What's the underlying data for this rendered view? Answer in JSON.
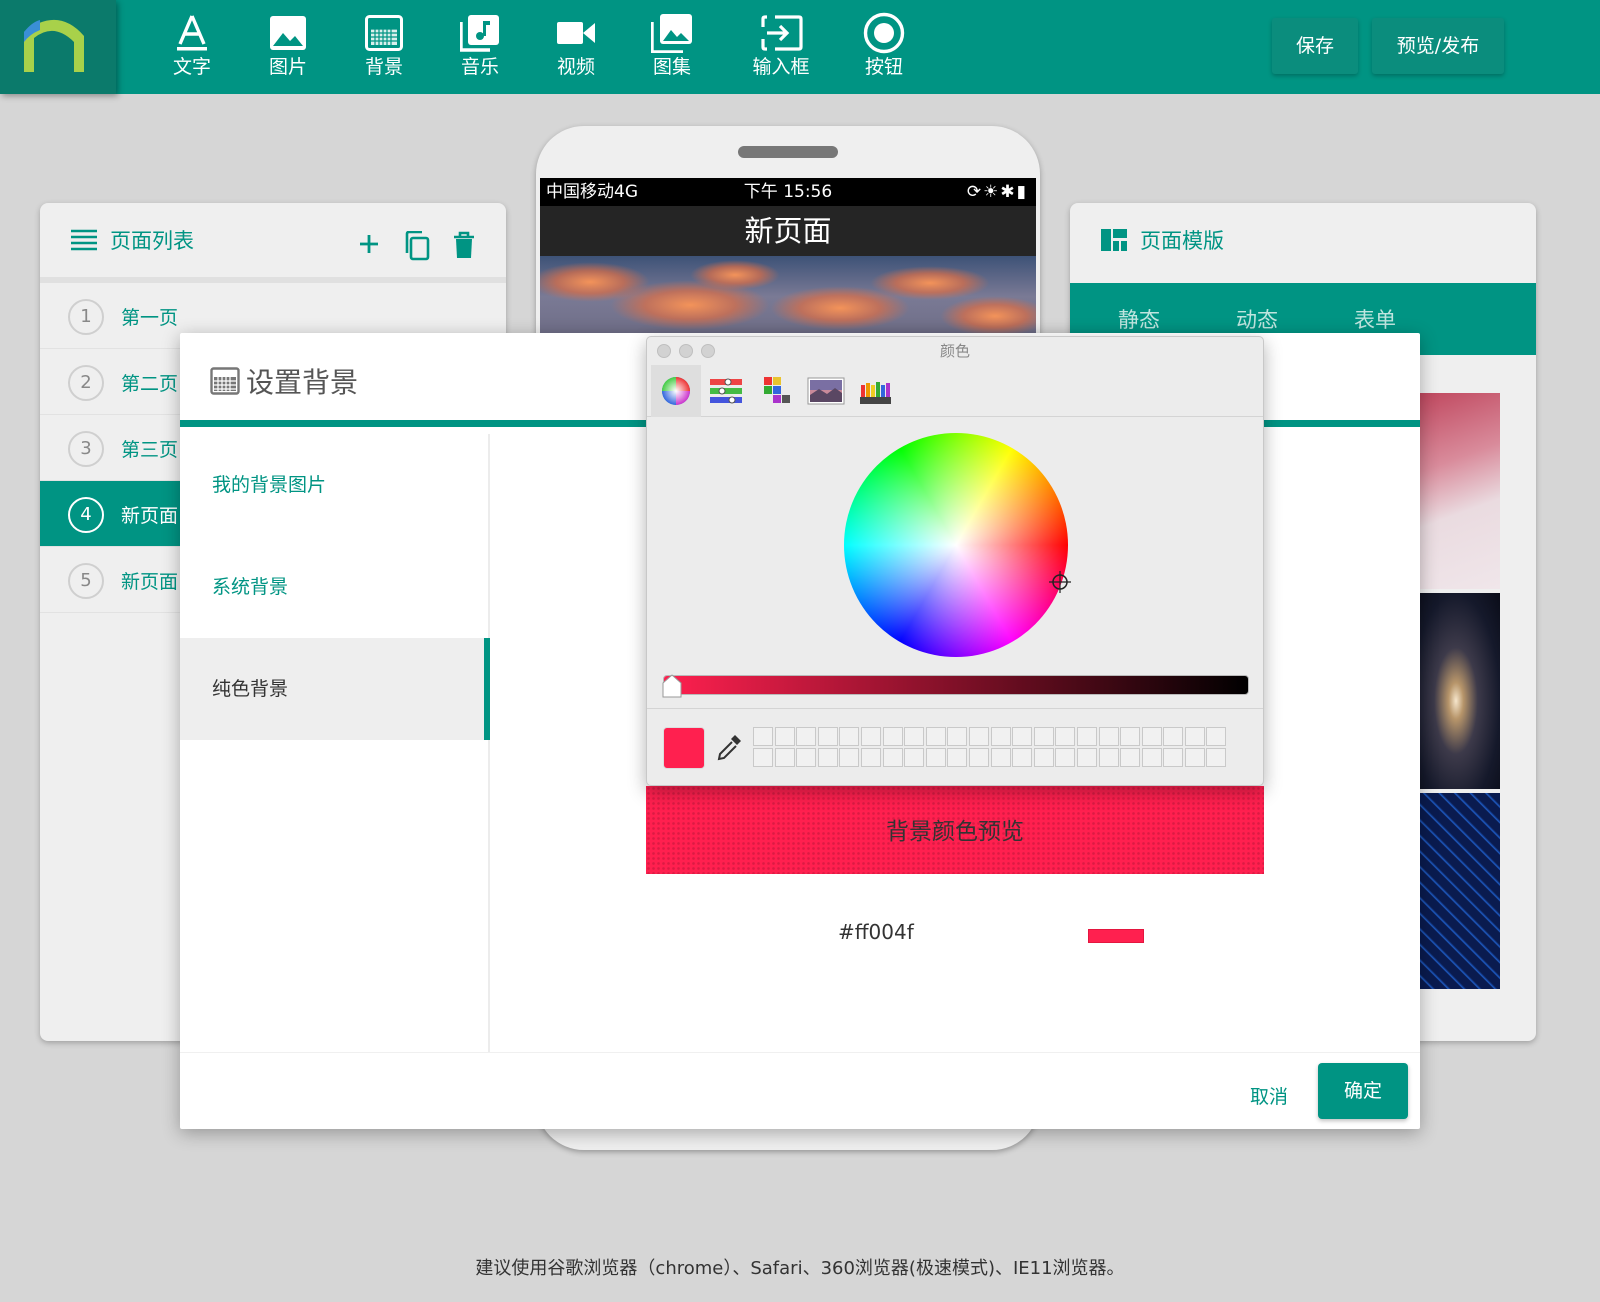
{
  "toolbar": {
    "items": [
      {
        "label": "文字",
        "icon": "text-icon"
      },
      {
        "label": "图片",
        "icon": "image-icon"
      },
      {
        "label": "背景",
        "icon": "background-icon"
      },
      {
        "label": "音乐",
        "icon": "music-icon"
      },
      {
        "label": "视频",
        "icon": "video-icon"
      },
      {
        "label": "图集",
        "icon": "gallery-icon"
      },
      {
        "label": "输入框",
        "icon": "input-box-icon"
      },
      {
        "label": "按钮",
        "icon": "button-icon"
      }
    ],
    "save_label": "保存",
    "publish_label": "预览/发布"
  },
  "phone": {
    "carrier": "中国移动4G",
    "time": "下午 15:56",
    "page_title": "新页面"
  },
  "page_list": {
    "title": "页面列表",
    "pages": [
      {
        "num": "1",
        "name": "第一页"
      },
      {
        "num": "2",
        "name": "第二页"
      },
      {
        "num": "3",
        "name": "第三页"
      },
      {
        "num": "4",
        "name": "新页面"
      },
      {
        "num": "5",
        "name": "新页面"
      }
    ],
    "active_index": 3
  },
  "templates": {
    "title": "页面模版",
    "tabs": [
      "静态",
      "动态",
      "表单"
    ]
  },
  "dialog": {
    "title": "设置背景",
    "nav": [
      "我的背景图片",
      "系统背景",
      "纯色背景"
    ],
    "selected_nav": 2,
    "preview_label": "背景颜色预览",
    "hex_value": "#ff004f",
    "cancel_label": "取消",
    "ok_label": "确定"
  },
  "color_picker": {
    "title": "颜色",
    "modes": [
      "color-wheel-icon",
      "sliders-icon",
      "palettes-icon",
      "image-palette-icon",
      "crayons-icon"
    ],
    "current_color": "#ff204f"
  },
  "colors": {
    "accent": "#009483",
    "selected": "#ff204f"
  },
  "footer": {
    "note": "建议使用谷歌浏览器（chrome）、Safari、360浏览器(极速模式)、IE11浏览器。"
  }
}
